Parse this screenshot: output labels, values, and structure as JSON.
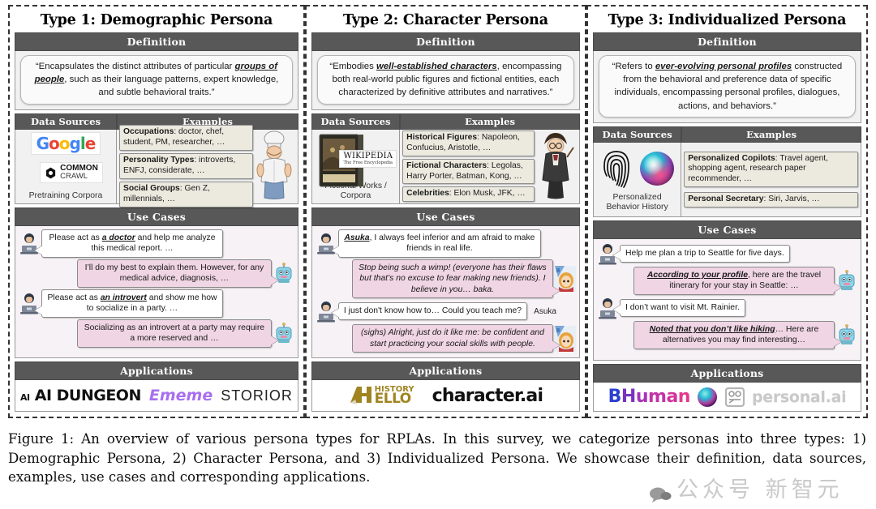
{
  "figure": {
    "caption_prefix": "Figure 1:",
    "caption": "Figure 1: An overview of various persona types for RPLAs. In this survey, we categorize personas into three types: 1) Demographic Persona, 2) Character Persona, and 3) Individualized Persona. We showcase their definition, data sources, examples, use cases and corresponding applications.",
    "watermark": "公众号 新智元"
  },
  "section_labels": {
    "definition": "Definition",
    "data_sources": "Data Sources",
    "examples": "Examples",
    "use_cases": "Use Cases",
    "applications": "Applications"
  },
  "colors": {
    "header_bar": "#585858",
    "section_bg": "#f1f1f1",
    "usecase_bg": "#f7f2f6",
    "bot_bubble": "#f0d5e4",
    "user_bubble": "#ffffff",
    "example_box": "#eceadf"
  },
  "panels": [
    {
      "title": "Type 1: Demographic Persona",
      "definition": {
        "pre": "“Encapsulates the distinct attributes of particular ",
        "highlight": "groups of people",
        "post": ", such as their language patterns, expert knowledge, and subtle behavioral traits.”"
      },
      "data_sources": {
        "caption": "Pretraining Corpora",
        "logos": [
          "google-logo",
          "common-crawl-logo"
        ],
        "logo_text": [
          "Google",
          "COMMON CRAWL"
        ]
      },
      "examples": [
        {
          "label": "Occupations",
          "value": ": doctor, chef, student, PM, researcher, …"
        },
        {
          "label": "Personality Types",
          "value": ": introverts, ENFJ, considerate, …"
        },
        {
          "label": "Social Groups",
          "value": ": Gen Z, millennials, …"
        }
      ],
      "example_art": "chef-illustration",
      "use_cases": [
        {
          "role": "user",
          "pre": "Please act as ",
          "highlight": "a doctor",
          "post": " and help me analyze this medical report. …",
          "avatar": "user-laptop-avatar"
        },
        {
          "role": "bot",
          "pre": "I’ll do my best to explain them. However, for any medical advice, diagnosis, …",
          "highlight": "",
          "post": "",
          "avatar": "robot-avatar"
        },
        {
          "role": "user",
          "pre": "Please act as ",
          "highlight": "an introvert",
          "post": " and show me how to socialize in a party. …",
          "avatar": "user-laptop-avatar"
        },
        {
          "role": "bot",
          "pre": "Socializing as an introvert at a party may require a more reserved and …",
          "highlight": "",
          "post": "",
          "avatar": "robot-avatar"
        }
      ],
      "applications": [
        "AI DUNGEON",
        "Ememe",
        "STORIOR"
      ]
    },
    {
      "title": "Type 2: Character Persona",
      "definition": {
        "pre": "“Embodies ",
        "highlight": "well-established characters",
        "post": ", encompassing both real-world public figures and fictional entities, each characterized by definitive attributes and narratives.”"
      },
      "data_sources": {
        "caption": "Fictional Works / Corpora",
        "logos": [
          "book-box-art",
          "wikipedia-logo"
        ],
        "logo_text": [
          "WIKIPEDIA",
          "The Free Encyclopedia"
        ]
      },
      "examples": [
        {
          "label": "Historical Figures",
          "value": ": Napoleon, Confucius, Aristotle, …"
        },
        {
          "label": "Fictional Characters",
          "value": ": Legolas, Harry Porter, Batman, Kong, …"
        },
        {
          "label": "Celebrities",
          "value": ": Elon Musk, JFK, …"
        }
      ],
      "example_art": "harry-potter-illustration",
      "use_cases": [
        {
          "role": "user",
          "pre": "",
          "highlight": "Asuka",
          "post": ", I always feel inferior and am afraid to make friends in real life.",
          "avatar": "user-laptop-avatar"
        },
        {
          "role": "bot",
          "pre": "",
          "highlight": "",
          "post": "Stop being such a wimp! (everyone has their flaws but that’s no excuse to fear making new friends). I believe in you… baka.",
          "avatar": "asuka-avatar"
        },
        {
          "role": "user",
          "pre": "I just don't know how to… Could you teach me?",
          "highlight": "",
          "post": "",
          "avatar": "user-laptop-avatar"
        },
        {
          "role": "bot",
          "pre": "",
          "highlight": "",
          "post": "(sighs) Alright, just do it like me: be confident and start practicing your social skills with people.",
          "avatar": "asuka-avatar"
        }
      ],
      "bot_name": "Asuka",
      "applications": [
        "HISTORY HELLO",
        "character.ai"
      ]
    },
    {
      "title": "Type 3: Individualized Persona",
      "definition": {
        "pre": "“Refers to ",
        "highlight": "ever-evolving personal profiles",
        "post": " constructed from the behavioral and preference data of specific individuals, encompassing personal profiles, dialogues, actions, and behaviors.”"
      },
      "data_sources": {
        "caption": "Personalized Behavior History",
        "logos": [
          "fingerprint-icon",
          "siri-orb-icon"
        ],
        "logo_text": []
      },
      "examples": [
        {
          "label": "Personalized Copilots",
          "value": ": Travel agent, shopping agent, research paper recommender, …"
        },
        {
          "label": "Personal Secretary",
          "value": ": Siri, Jarvis, …"
        }
      ],
      "example_art": "",
      "use_cases": [
        {
          "role": "user",
          "pre": "Help me plan a trip to Seattle for five days.",
          "highlight": "",
          "post": "",
          "avatar": "user-laptop-avatar"
        },
        {
          "role": "bot",
          "pre": "",
          "highlight": "According to your profile",
          "post": ", here are the travel itinerary for your stay in Seattle: …",
          "avatar": "robot-avatar"
        },
        {
          "role": "user",
          "pre": "I don’t want to visit Mt. Rainier.",
          "highlight": "",
          "post": "",
          "avatar": "user-laptop-avatar"
        },
        {
          "role": "bot",
          "pre": "",
          "highlight": "Noted that you don’t like hiking",
          "post": "… Here are alternatives you may find interesting…",
          "avatar": "robot-avatar"
        }
      ],
      "applications": [
        "BHuman",
        "personal.ai"
      ]
    }
  ]
}
